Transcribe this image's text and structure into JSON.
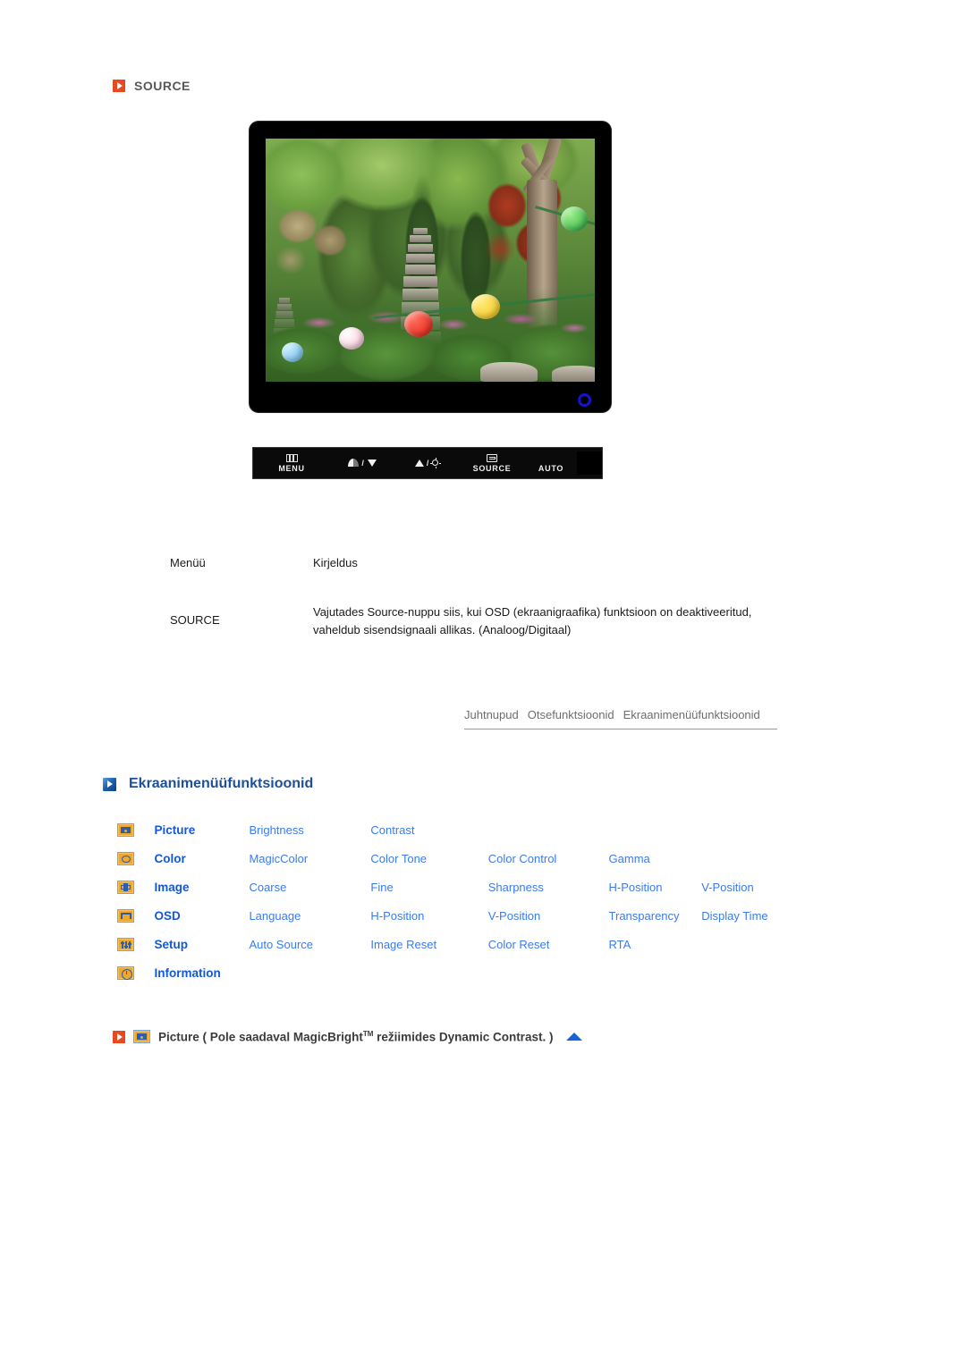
{
  "source_section": {
    "title": "SOURCE",
    "icon": "arrow-square-icon"
  },
  "monitor": {
    "alt": "lcd-monitor-product-photo",
    "power_led": "power-led-indicator"
  },
  "control_panel": {
    "buttons": [
      {
        "label": "MENU",
        "icon": "menu-grid-icon"
      },
      {
        "label": "",
        "icon": "contrast-down-icon"
      },
      {
        "label": "",
        "icon": "brightness-up-icon"
      },
      {
        "label": "SOURCE",
        "icon": "source-switch-icon"
      },
      {
        "label": "AUTO",
        "icon": "auto-adjust-icon"
      },
      {
        "label": "",
        "icon": "power-button-icon"
      }
    ],
    "menu_label": "MENU",
    "source_label": "SOURCE",
    "auto_label": "AUTO",
    "slash": "/"
  },
  "description_table": {
    "header": {
      "menu": "Menüü",
      "description": "Kirjeldus"
    },
    "rows": [
      {
        "menu": "SOURCE",
        "description": "Vajutades Source-nuppu siis, kui OSD (ekraanigraafika) funktsioon on deaktiveeritud, vaheldub sisendsignaali allikas. (Analoog/Digitaal)"
      }
    ]
  },
  "nav_links": [
    "Juhtnupud",
    "Otsefunktsioonid",
    "Ekraanimenüüfunktsioonid"
  ],
  "osd_section": {
    "heading": "Ekraanimenüüfunktsioonid",
    "rows": [
      {
        "icon": "picture-icon",
        "main": "Picture",
        "items": [
          "Brightness",
          "Contrast"
        ]
      },
      {
        "icon": "color-icon",
        "main": "Color",
        "items": [
          "MagicColor",
          "Color Tone",
          "Color Control",
          "Gamma"
        ]
      },
      {
        "icon": "image-icon",
        "main": "Image",
        "items": [
          "Coarse",
          "Fine",
          "Sharpness",
          "H-Position",
          "V-Position"
        ]
      },
      {
        "icon": "osd-icon",
        "main": "OSD",
        "items": [
          "Language",
          "H-Position",
          "V-Position",
          "Transparency",
          "Display Time"
        ]
      },
      {
        "icon": "setup-icon",
        "main": "Setup",
        "items": [
          "Auto Source",
          "Image Reset",
          "Color Reset",
          "RTA"
        ]
      },
      {
        "icon": "information-icon",
        "main": "Information",
        "items": []
      }
    ]
  },
  "bottom_note": {
    "text_before": "Picture ( Pole saadaval MagicBright",
    "superscript": "TM",
    "text_after": " režiimides Dynamic Contrast. )",
    "back_to_top": "back-to-top-arrow"
  },
  "colors": {
    "orange_accent": "#e8491f",
    "blue_link": "#3a7bf0",
    "blue_heading": "#1c4f9c",
    "menu_icon_fill": "#f0a72a",
    "grey_text": "#6e6e6e"
  }
}
